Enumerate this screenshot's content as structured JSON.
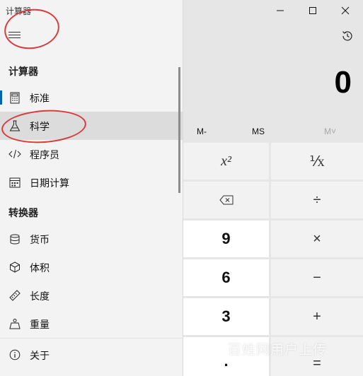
{
  "window": {
    "title": "计算器",
    "controls": {
      "minimize": "—",
      "maximize": "☐",
      "close": "✕"
    }
  },
  "display": {
    "value": "0"
  },
  "memory": {
    "m_minus": "M-",
    "ms": "MS",
    "m_view": "M˅"
  },
  "keypad": {
    "square": "x²",
    "reciprocal": "⅟x",
    "backspace": "⌫",
    "divide": "÷",
    "nine": "9",
    "multiply": "×",
    "six": "6",
    "minus": "−",
    "three": "3",
    "plus": "+",
    "decimal": ".",
    "equals": "="
  },
  "nav": {
    "calculator_header": "计算器",
    "converter_header": "转换器",
    "items": [
      {
        "label": "标准",
        "icon": "calculator-icon"
      },
      {
        "label": "科学",
        "icon": "flask-icon"
      },
      {
        "label": "程序员",
        "icon": "code-icon"
      },
      {
        "label": "日期计算",
        "icon": "calendar-icon"
      },
      {
        "label": "货币",
        "icon": "coins-icon"
      },
      {
        "label": "体积",
        "icon": "cube-icon"
      },
      {
        "label": "长度",
        "icon": "ruler-icon"
      },
      {
        "label": "重量",
        "icon": "weight-icon"
      },
      {
        "label": "关于",
        "icon": "info-icon"
      }
    ]
  },
  "watermark": "百姓网用户上传",
  "colors": {
    "accent": "#0063b1",
    "annotation": "#d93a3a",
    "nav_background": "#f3f3f3",
    "selected_item": "#dcdcdc"
  }
}
